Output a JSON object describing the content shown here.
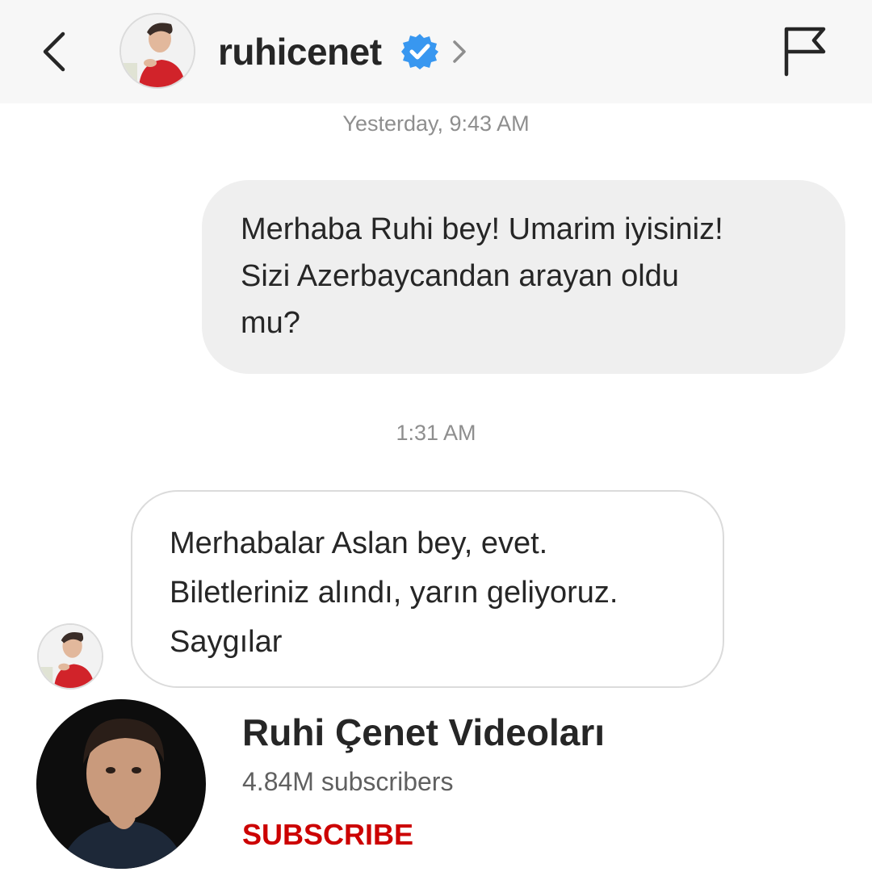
{
  "header": {
    "username": "ruhicenet",
    "back_icon": "chevron-left-icon",
    "verified_icon": "verified-badge-icon",
    "chevron_icon": "chevron-right-icon",
    "flag_icon": "flag-icon"
  },
  "thread": {
    "timestamps": [
      "Yesterday, 9:43 AM",
      "1:31 AM"
    ],
    "outgoing_message": {
      "lines": [
        "Merhaba Ruhi bey! Umarim iyisiniz!",
        "Sizi Azerbaycandan arayan oldu",
        "mu?"
      ]
    },
    "incoming_message": {
      "lines": [
        "Merhabalar Aslan bey, evet.",
        "Biletleriniz alındı, yarın geliyoruz.",
        "Saygılar"
      ]
    }
  },
  "youtube_card": {
    "channel_name": "Ruhi Çenet Videoları",
    "subscribers": "4.84M subscribers",
    "subscribe_label": "SUBSCRIBE"
  },
  "colors": {
    "header_bg": "#f7f7f7",
    "outgoing_bubble": "#efefef",
    "incoming_border": "#dbdbdb",
    "verified_blue": "#3897f0",
    "timestamp_gray": "#8e8e8e",
    "subscribe_red": "#cc0000"
  }
}
